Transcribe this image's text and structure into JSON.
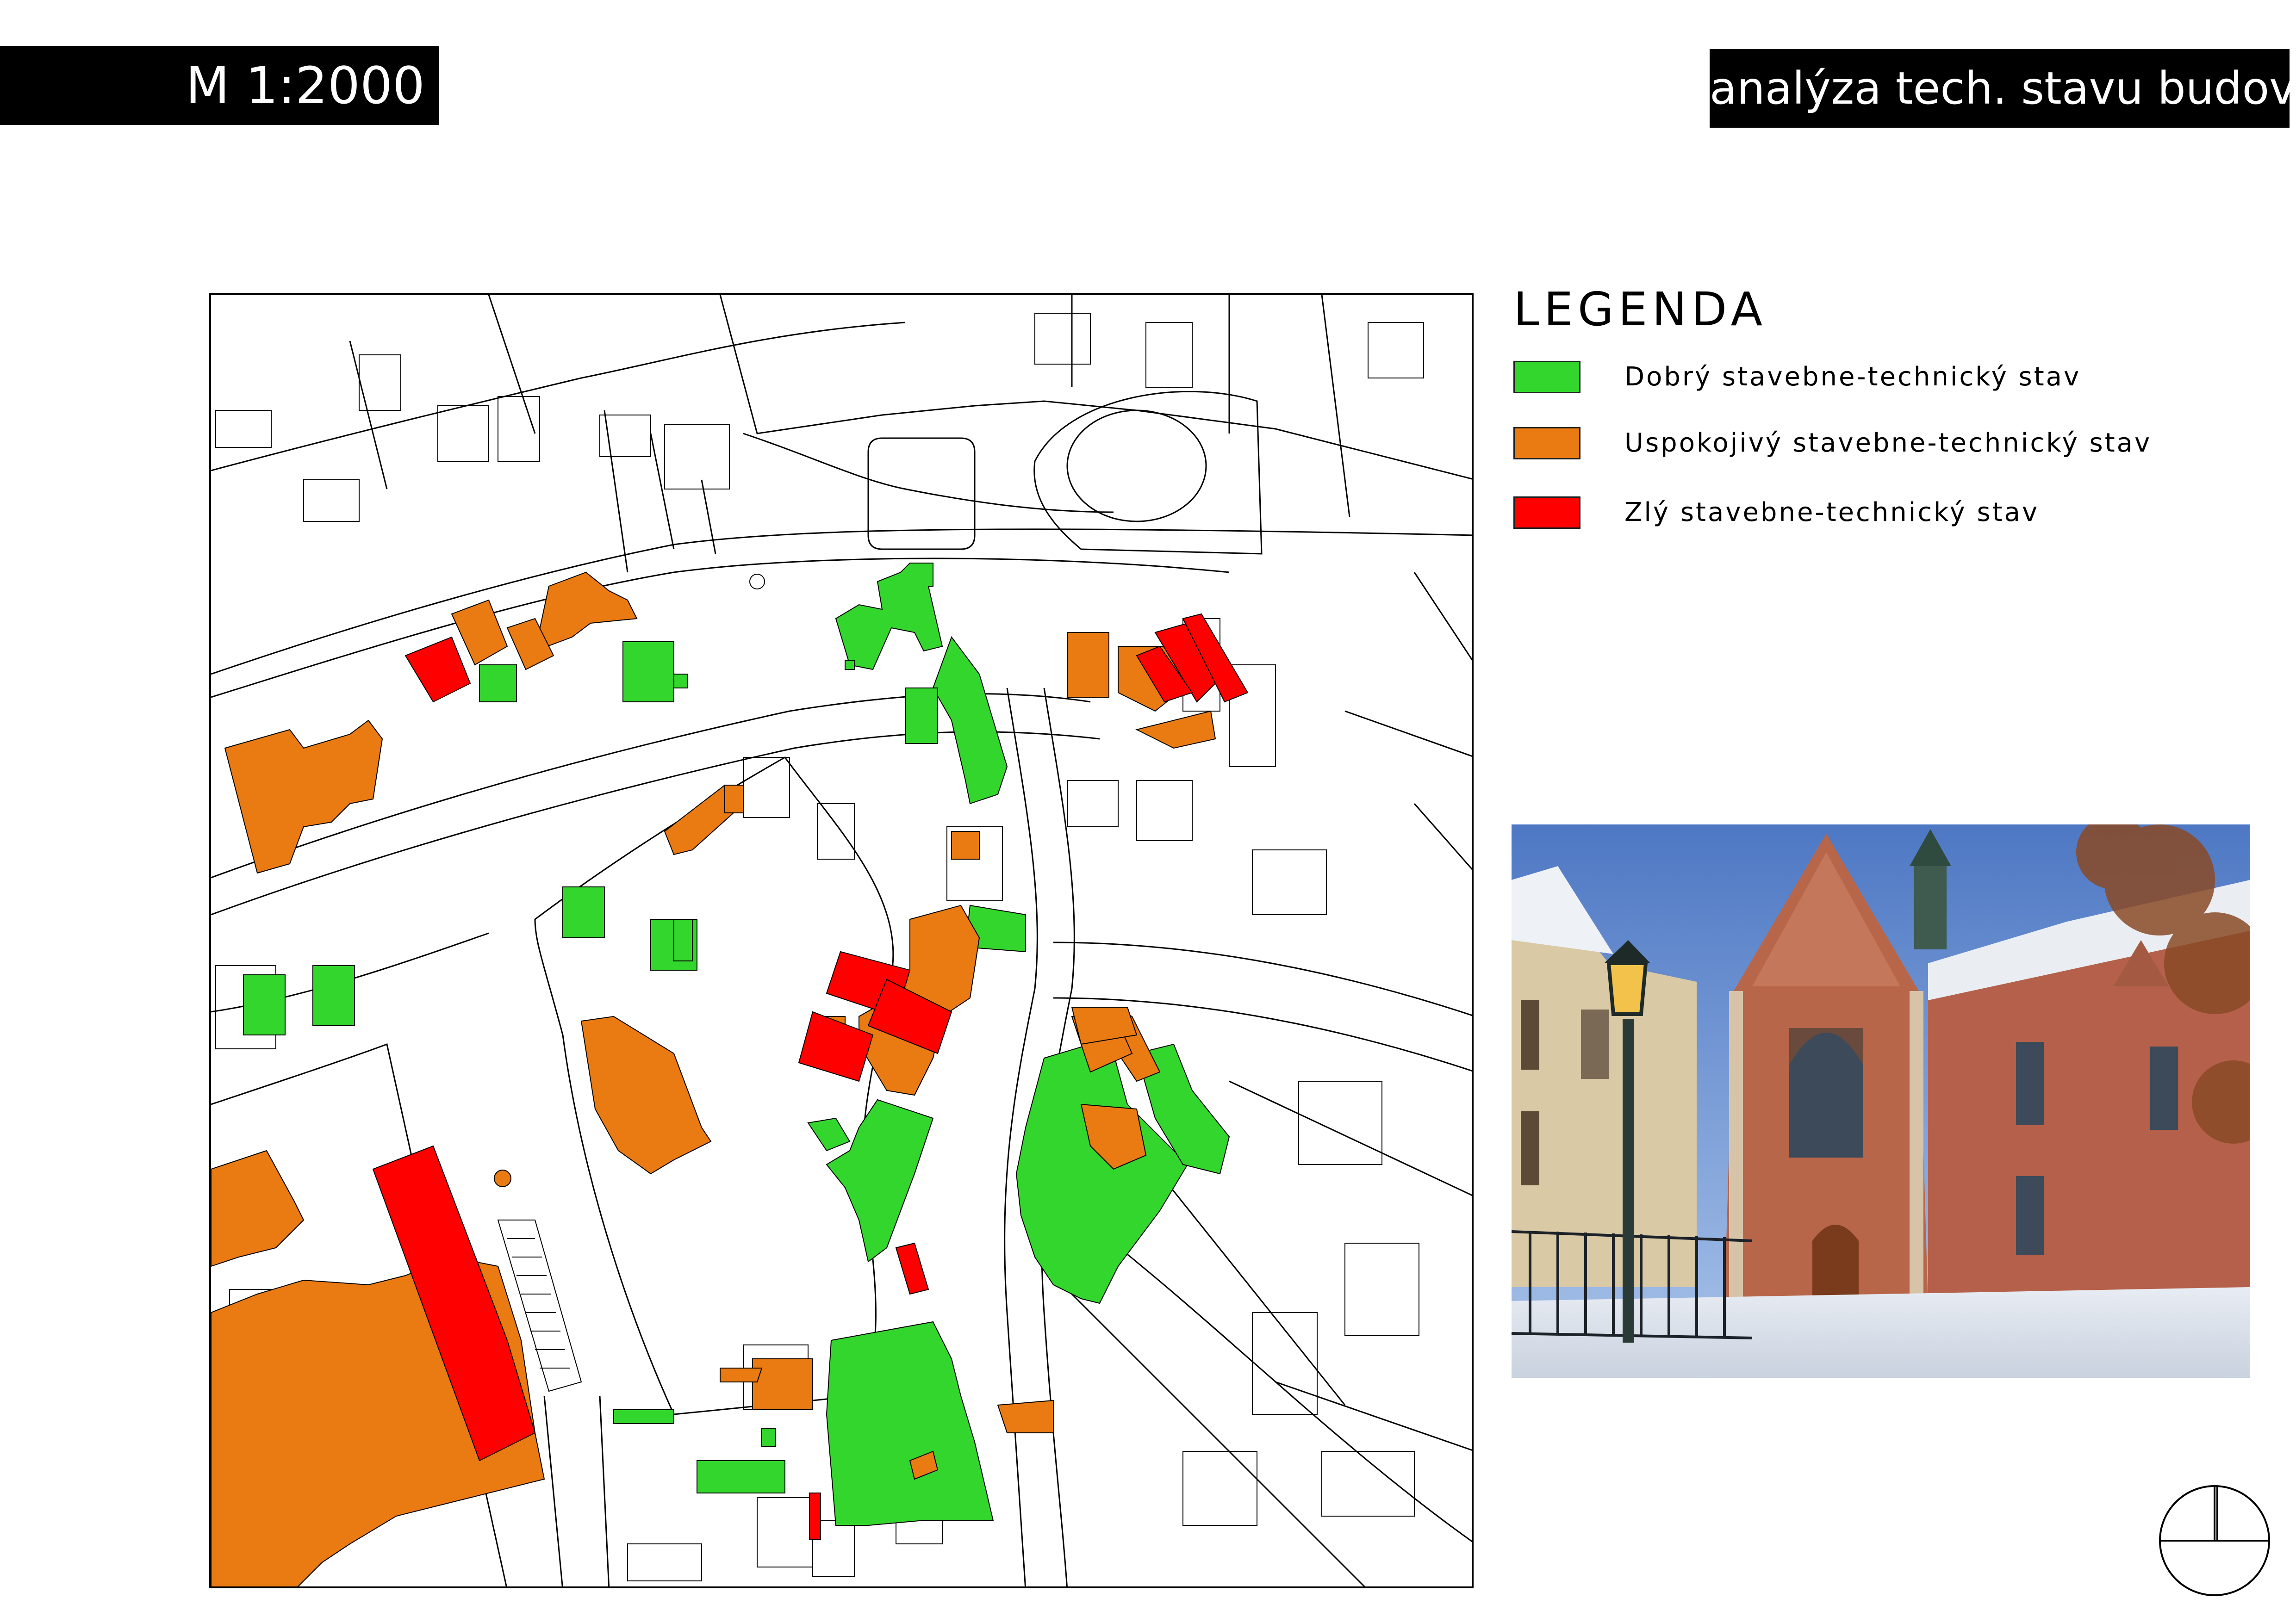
{
  "header": {
    "scale": "M 1:2000",
    "title": "analýza tech. stavu budov"
  },
  "legend": {
    "title": "LEGENDA",
    "items": [
      {
        "label": "Dobrý stavebne-technický stav",
        "color": "#33d62c"
      },
      {
        "label": "Uspokojivý stavebne-technický stav",
        "color": "#ea7a12"
      },
      {
        "label": "Zlý stavebne-technický stav",
        "color": "#ff0000"
      }
    ]
  },
  "map": {
    "colors": {
      "good": "#33d62c",
      "satisfactory": "#ea7a12",
      "poor": "#ff0000",
      "outline": "#000000",
      "background": "#ffffff"
    }
  },
  "photo": {
    "subject": "gothic-church-in-winter"
  },
  "north_arrow": {
    "icon": "north-arrow-icon"
  }
}
